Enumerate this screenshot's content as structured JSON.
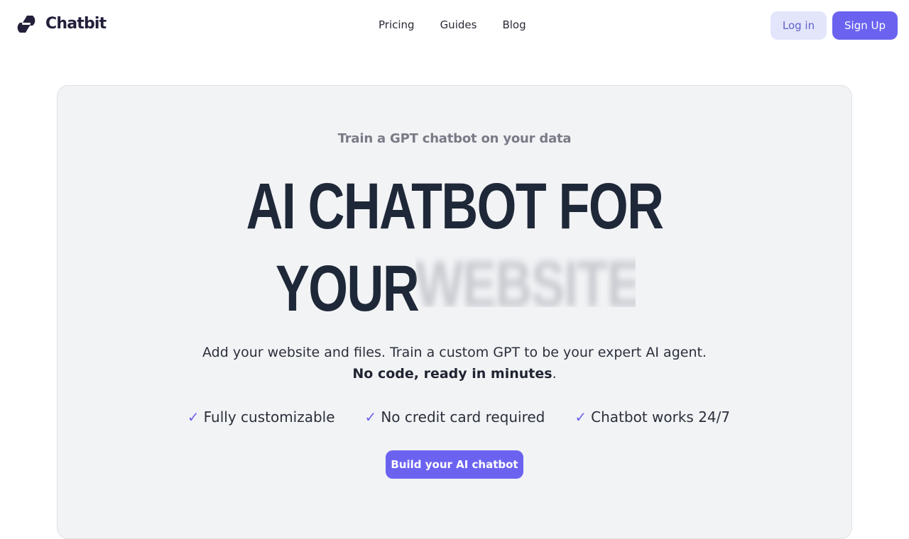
{
  "brand": {
    "name": "Chatbit",
    "logo_icon": "chatbit-logo-icon",
    "color": "#231f3a"
  },
  "nav": {
    "links": [
      {
        "label": "Pricing"
      },
      {
        "label": "Guides"
      },
      {
        "label": "Blog"
      }
    ],
    "login_label": "Log in",
    "signup_label": "Sign Up"
  },
  "hero": {
    "eyebrow": "Train a GPT chatbot on your data",
    "headline_line1": "AI CHATBOT FOR",
    "headline_line2": "YOUR",
    "rotating_word": "WEBSITE",
    "description_line1": "Add your website and files. Train a custom GPT to be your expert AI agent.",
    "description_bold": "No code, ready in minutes",
    "description_end": ".",
    "features": [
      {
        "icon": "checkmark-icon",
        "label": "Fully customizable"
      },
      {
        "icon": "checkmark-icon",
        "label": "No credit card required"
      },
      {
        "icon": "checkmark-icon",
        "label": "Chatbot works 24/7"
      }
    ],
    "cta_label": "Build your AI chatbot"
  },
  "colors": {
    "accent": "#6b63f0",
    "accent_soft": "#e3e5fb",
    "hero_bg": "#f2f3f5",
    "headline": "#1e2838",
    "eyebrow": "#7a7a87"
  }
}
